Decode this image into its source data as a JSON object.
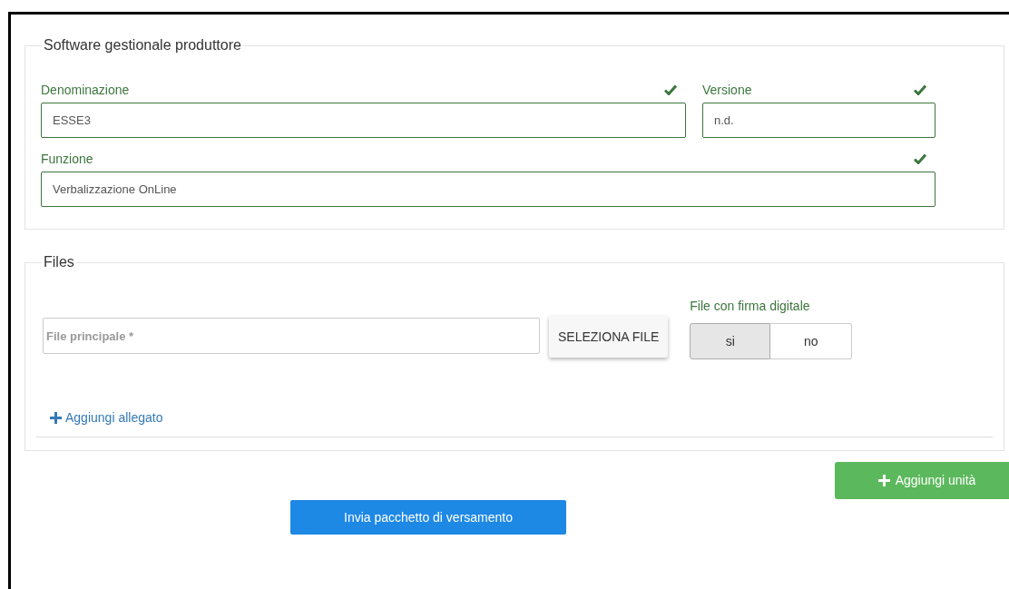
{
  "software_section": {
    "legend": "Software gestionale produttore",
    "fields": [
      {
        "label": "Denominazione",
        "value": "ESSE3",
        "valid": true
      },
      {
        "label": "Versione",
        "value": "n.d.",
        "valid": true
      },
      {
        "label": "Funzione",
        "value": "Verbalizzazione OnLine",
        "valid": true
      }
    ]
  },
  "files_section": {
    "legend": "Files",
    "file_field": {
      "placeholder": "File principale *"
    },
    "select_button": "SELEZIONA FILE",
    "signature": {
      "label": "File con firma digitale",
      "options": [
        {
          "label": "si",
          "selected": true
        },
        {
          "label": "no",
          "selected": false
        }
      ]
    },
    "add_attachment": "Aggiungi allegato"
  },
  "add_unit_button": "Aggiungi unità",
  "submit_button": "Invia pacchetto di versamento"
}
